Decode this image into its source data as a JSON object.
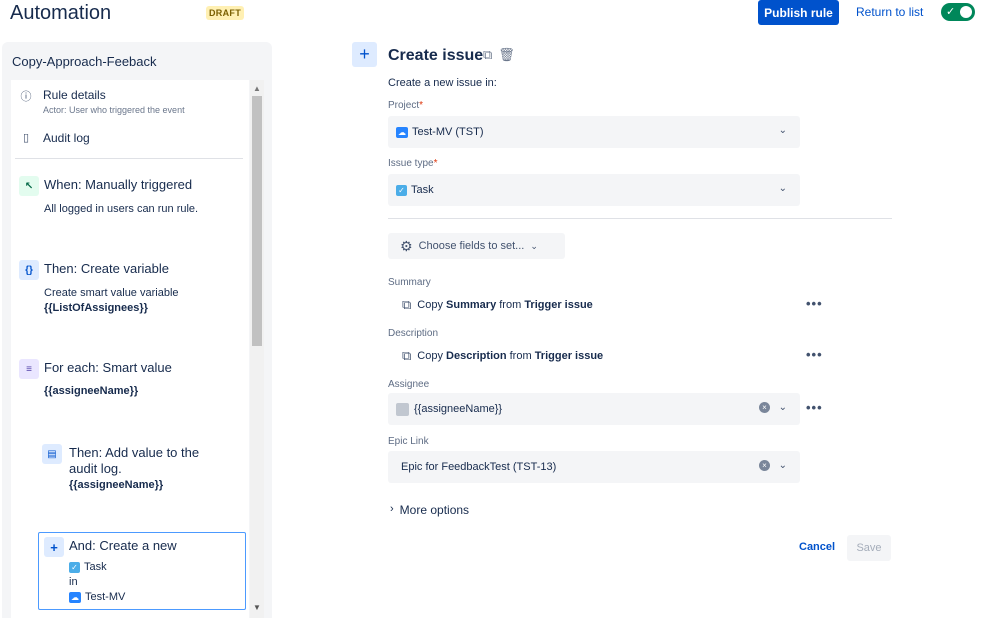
{
  "header": {
    "title": "Automation",
    "badge": "DRAFT",
    "publish_label": "Publish rule",
    "return_label": "Return to list",
    "toggle_state": "on"
  },
  "sidebar": {
    "rule_name": "Copy-Approach-Feeback",
    "rule_details": "Rule details",
    "actor": "Actor: User who triggered the event",
    "audit_log": "Audit log",
    "components": [
      {
        "icon": "cursor-icon",
        "title": "When: Manually triggered",
        "desc": "All logged in users can run rule."
      },
      {
        "icon": "braces-icon",
        "title": "Then: Create variable",
        "desc": "Create smart value variable",
        "value": "{{ListOfAssignees}}"
      },
      {
        "icon": "list-icon",
        "title": "For each: Smart value",
        "value": "{{assigneeName}}"
      },
      {
        "icon": "audit-log-icon",
        "title_line1": "Then: Add value to the",
        "title_line2": "audit log.",
        "value": "{{assigneeName}}"
      },
      {
        "icon": "plus-icon",
        "title": "And: Create a new",
        "type": "Task",
        "in": "in",
        "project": "Test-MV"
      }
    ]
  },
  "form": {
    "title": "Create issue",
    "subtitle": "Create a new issue in:",
    "project_label": "Project",
    "project_value": "Test-MV (TST)",
    "issue_type_label": "Issue type",
    "issue_type_value": "Task",
    "choose_fields": "Choose fields to set...",
    "summary_label": "Summary",
    "summary_copy": "Copy",
    "summary_field": "Summary",
    "from": "from",
    "summary_source": "Trigger issue",
    "description_label": "Description",
    "description_copy": "Copy",
    "description_field": "Description",
    "description_source": "Trigger issue",
    "assignee_label": "Assignee",
    "assignee_value": "{{assigneeName}}",
    "epic_label": "Epic Link",
    "epic_value": "Epic for FeedbackTest (TST-13)",
    "more_options": "More options",
    "cancel": "Cancel",
    "save": "Save",
    "required_mark": "*"
  },
  "colors": {
    "primary": "#0052cc",
    "toggle_on": "#00875a",
    "draft_bg": "#fff0b3",
    "field_bg": "#f4f5f7"
  }
}
